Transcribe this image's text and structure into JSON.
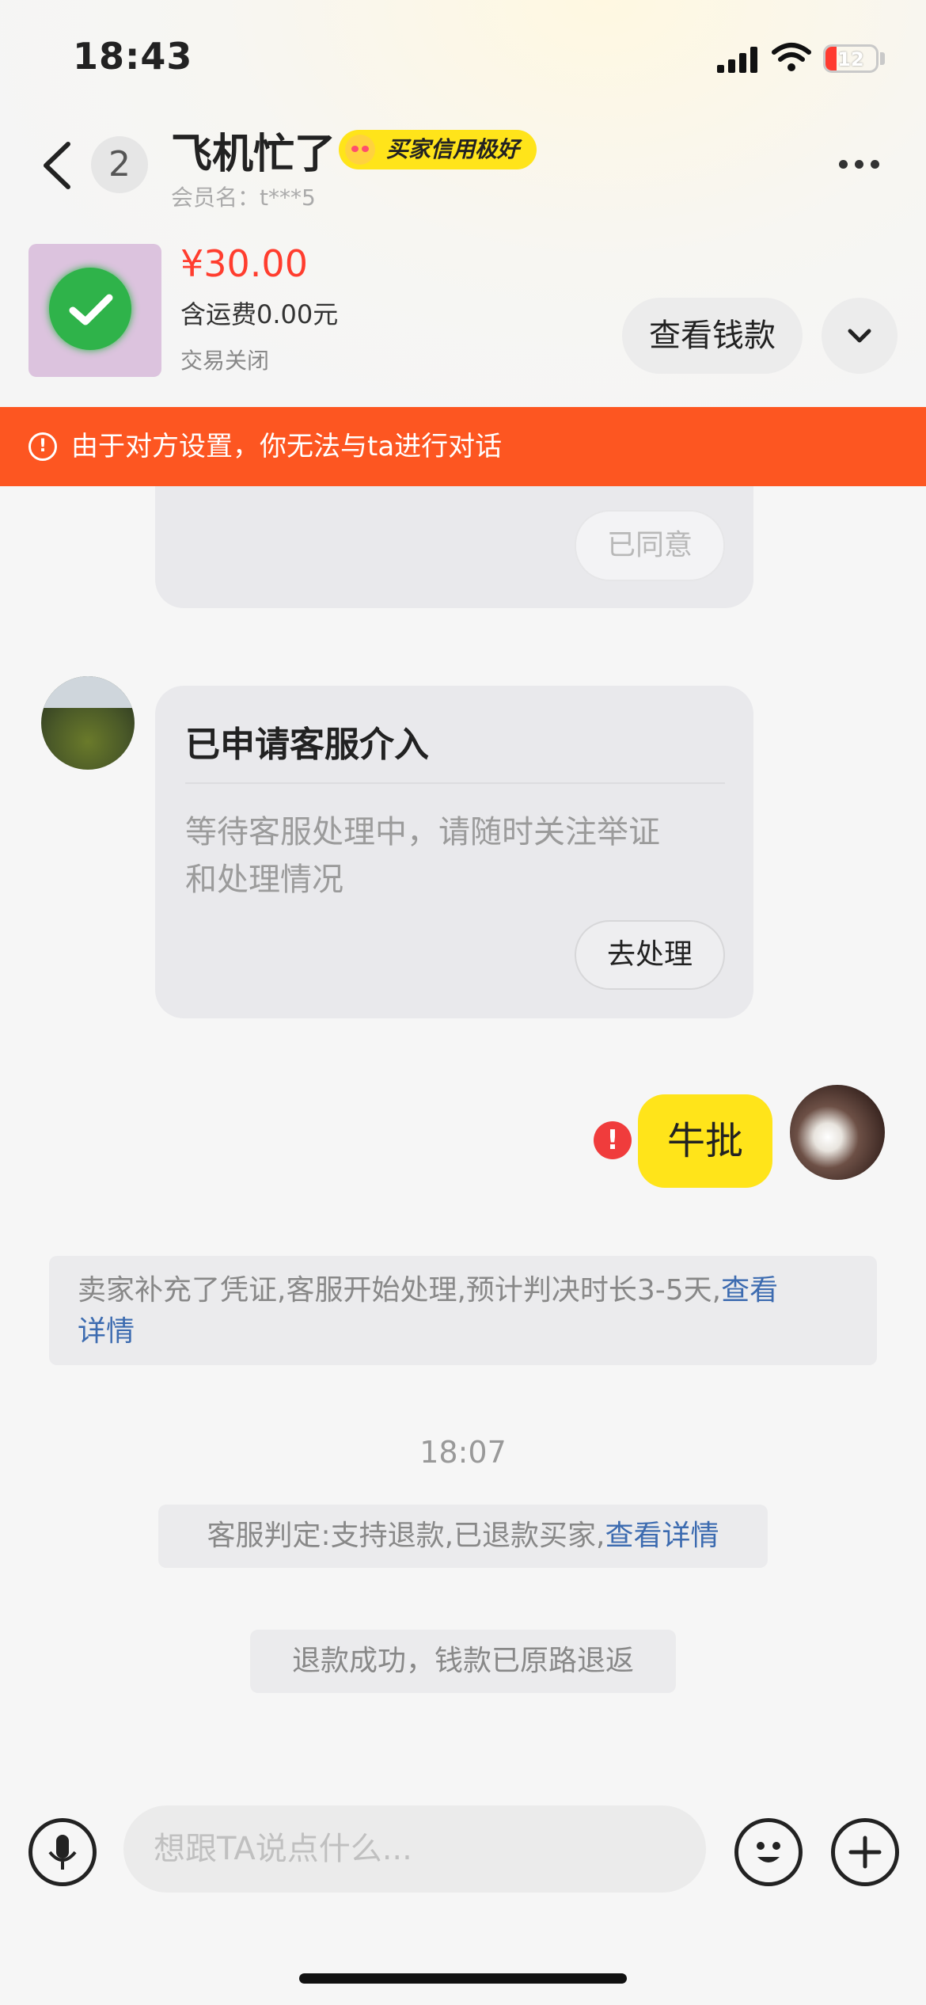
{
  "status_bar": {
    "time": "18:43",
    "battery": "12"
  },
  "header": {
    "unread_count": "2",
    "title": "飞机忙了",
    "credit_badge": "买家信用极好",
    "member_name": "会员名：t***5"
  },
  "order": {
    "price": "¥30.00",
    "shipping": "含运费0.00元",
    "status": "交易关闭",
    "view_button": "查看钱款"
  },
  "notice": {
    "text": "由于对方设置，你无法与ta进行对话"
  },
  "messages": {
    "agreed_button": "已同意",
    "intervention": {
      "title": "已申请客服介入",
      "body_line1": "等待客服处理中，请随时关注举证",
      "body_line2": "和处理情况",
      "action": "去处理"
    },
    "my_message": "牛批",
    "system1": {
      "text": "卖家补充了凭证,客服开始处理,预计判决时长3-5天,",
      "link": "查看",
      "link2": "详情"
    },
    "timestamp": "18:07",
    "system2": {
      "text": "客服判定:支持退款,已退款买家,",
      "link": "查看详情"
    },
    "system3": {
      "text": "退款成功，钱款已原路退返"
    }
  },
  "input_bar": {
    "placeholder": "想跟TA说点什么..."
  },
  "colors": {
    "accent_yellow": "#ffe41a",
    "notice_orange": "#fd5621",
    "price_red": "#ff3d2e",
    "link_blue": "#3c6bb0"
  }
}
